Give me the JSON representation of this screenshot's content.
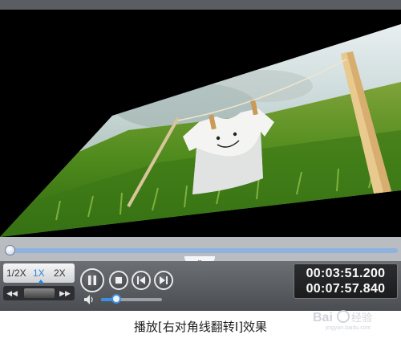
{
  "player": {
    "speed_options": [
      "1/2X",
      "1X",
      "2X"
    ],
    "current_time": "00:03:51.200",
    "total_time": "00:07:57.840",
    "progress": 0.008,
    "volume": 0.25,
    "icons": {
      "rewind": "double-left-arrow-icon",
      "forward": "double-right-arrow-icon",
      "pause": "pause-icon",
      "stop": "stop-icon",
      "prev": "previous-frame-icon",
      "next": "next-frame-icon",
      "volume": "speaker-icon",
      "collapse": "chevron-down-icon"
    },
    "accent_color": "#2e86d6"
  },
  "caption": "播放[右对角线翻转Ⅰ]效果",
  "watermark": {
    "text": "Bai 经验",
    "subtext": "jingyan.baidu.com"
  }
}
